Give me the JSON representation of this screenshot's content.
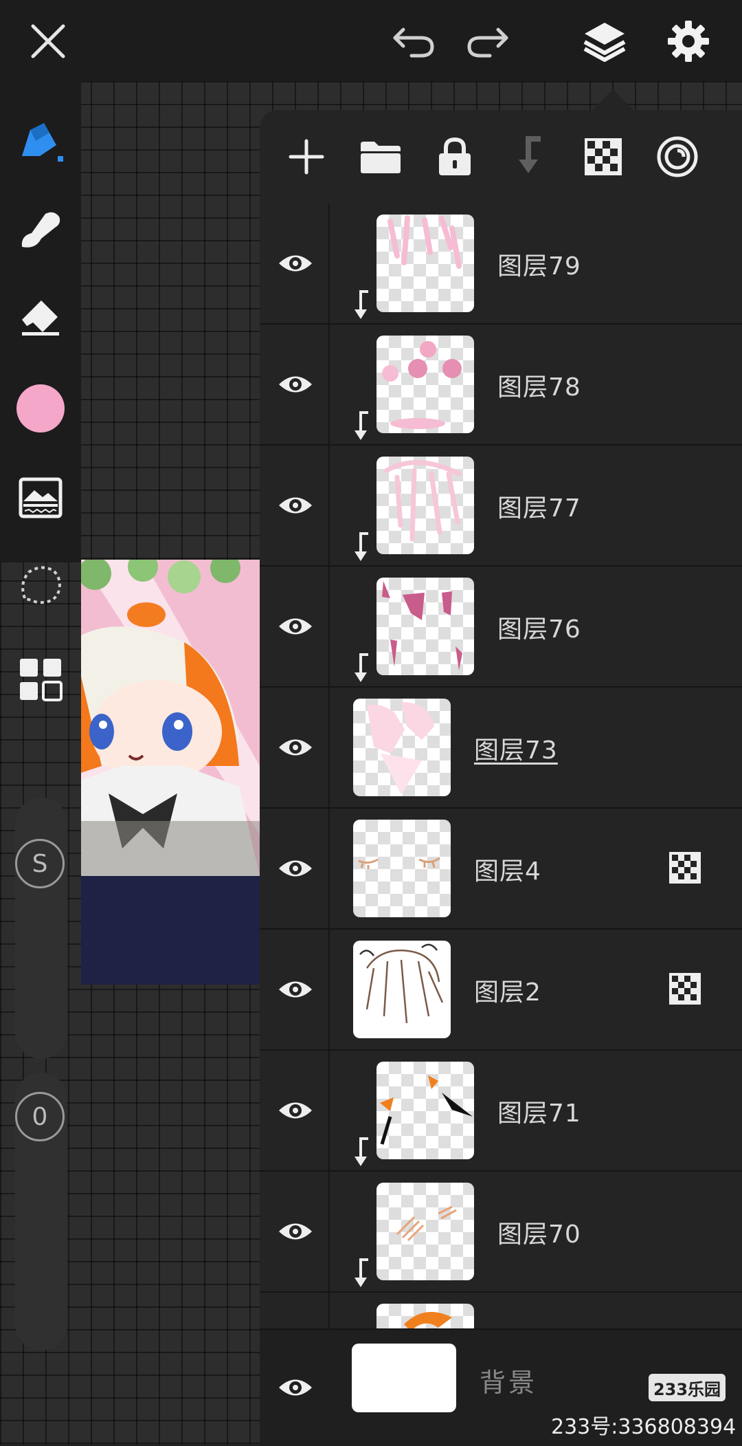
{
  "colors": {
    "accent": "#2f8ff0",
    "current_color": "#f5a7c9",
    "panel_bg": "#242424",
    "toolbar_bg": "#1c1c1c"
  },
  "topbar": {
    "icons": [
      "close-icon",
      "undo-icon",
      "redo-icon",
      "layers-icon",
      "gear-icon"
    ]
  },
  "left_toolbar": {
    "tools": [
      "pen-icon",
      "smudge-icon",
      "eraser-icon",
      "color-swatch",
      "image-adjust-icon",
      "lasso-icon",
      "gallery-icon"
    ],
    "size_slider_label": "S",
    "opacity_slider_label": "0"
  },
  "layer_panel": {
    "tools": [
      "add-layer-icon",
      "folder-icon",
      "lock-icon",
      "merge-down-icon",
      "alpha-lock-icon",
      "blend-icon"
    ],
    "layers": [
      {
        "name": "图层79",
        "clipped": true,
        "alpha_locked": false,
        "selected": false
      },
      {
        "name": "图层78",
        "clipped": true,
        "alpha_locked": false,
        "selected": false
      },
      {
        "name": "图层77",
        "clipped": true,
        "alpha_locked": false,
        "selected": false
      },
      {
        "name": "图层76",
        "clipped": true,
        "alpha_locked": false,
        "selected": false
      },
      {
        "name": "图层73",
        "clipped": false,
        "alpha_locked": false,
        "selected": true
      },
      {
        "name": "图层4",
        "clipped": false,
        "alpha_locked": true,
        "selected": false
      },
      {
        "name": "图层2",
        "clipped": false,
        "alpha_locked": true,
        "selected": false
      },
      {
        "name": "图层71",
        "clipped": true,
        "alpha_locked": false,
        "selected": false
      },
      {
        "name": "图层70",
        "clipped": true,
        "alpha_locked": false,
        "selected": false
      }
    ],
    "background_label": "背景"
  },
  "watermark": {
    "badge": "233乐园",
    "id_text": "233号:336808394"
  }
}
